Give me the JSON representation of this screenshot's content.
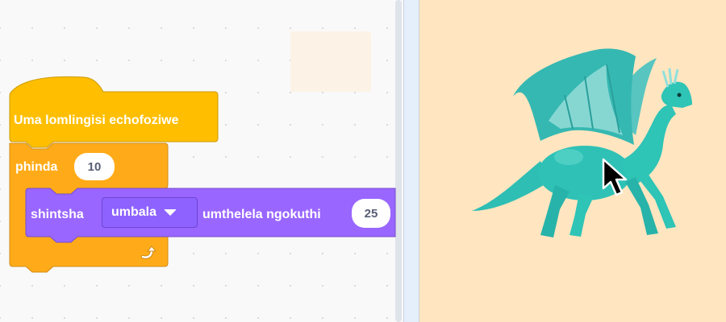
{
  "colors": {
    "events": "#ffbf00",
    "control": "#ffab19",
    "looks": "#9966ff",
    "stage_bg": "#ffe6c0",
    "sprite": "#2ec4b6"
  },
  "script": {
    "hat_label": "Uma lomlingisi echofoziwe",
    "repeat_label": "phinda",
    "repeat_count": "10",
    "effect_prefix": "shintsha",
    "effect_dropdown_value": "umbala",
    "effect_suffix": "umthelela ngokuthi",
    "effect_amount": "25"
  },
  "icons": {
    "loop_arrow": "loop-arrow-icon",
    "dropdown_caret": "caret-down-icon",
    "cursor": "mouse-pointer-icon",
    "sprite": "dragon-sprite"
  }
}
